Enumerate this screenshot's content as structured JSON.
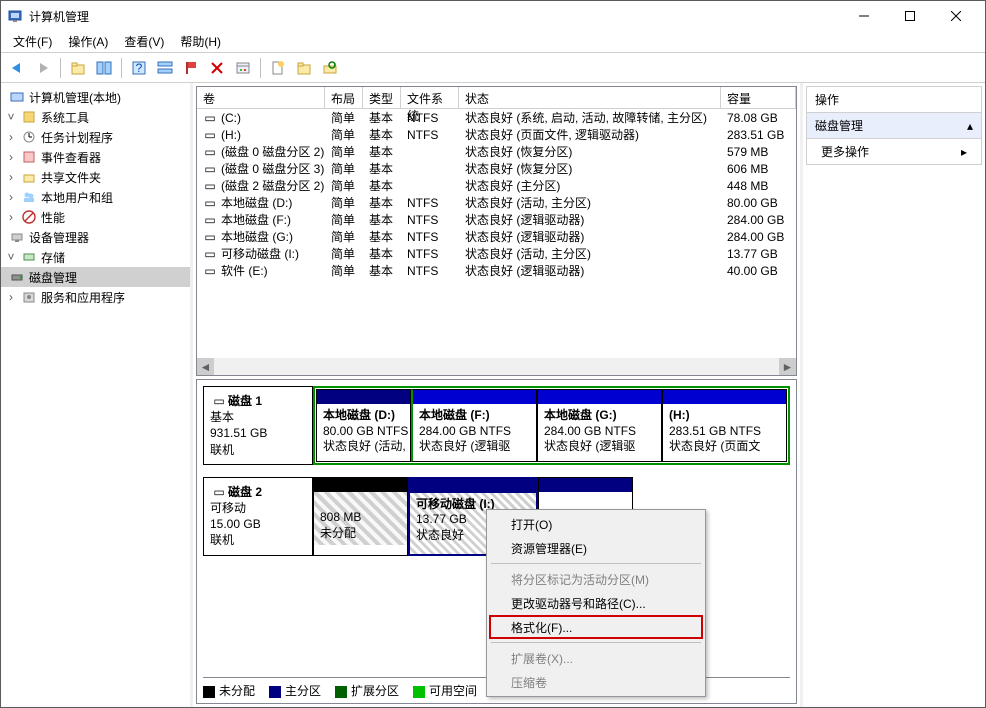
{
  "window": {
    "title": "计算机管理"
  },
  "menu": {
    "file": "文件(F)",
    "action": "操作(A)",
    "view": "查看(V)",
    "help": "帮助(H)"
  },
  "tree": {
    "root": "计算机管理(本地)",
    "sys_tools": "系统工具",
    "task_scheduler": "任务计划程序",
    "event_viewer": "事件查看器",
    "shared_folders": "共享文件夹",
    "local_users": "本地用户和组",
    "performance": "性能",
    "device_manager": "设备管理器",
    "storage": "存储",
    "disk_management": "磁盘管理",
    "services_apps": "服务和应用程序"
  },
  "vol_header": {
    "volume": "卷",
    "layout": "布局",
    "type": "类型",
    "fs": "文件系统",
    "status": "状态",
    "capacity": "容量"
  },
  "volumes": [
    {
      "name": "(C:)",
      "layout": "简单",
      "type": "基本",
      "fs": "NTFS",
      "status": "状态良好 (系统, 启动, 活动, 故障转储, 主分区)",
      "cap": "78.08 GB"
    },
    {
      "name": "(H:)",
      "layout": "简单",
      "type": "基本",
      "fs": "NTFS",
      "status": "状态良好 (页面文件, 逻辑驱动器)",
      "cap": "283.51 GB"
    },
    {
      "name": "(磁盘 0 磁盘分区 2)",
      "layout": "简单",
      "type": "基本",
      "fs": "",
      "status": "状态良好 (恢复分区)",
      "cap": "579 MB"
    },
    {
      "name": "(磁盘 0 磁盘分区 3)",
      "layout": "简单",
      "type": "基本",
      "fs": "",
      "status": "状态良好 (恢复分区)",
      "cap": "606 MB"
    },
    {
      "name": "(磁盘 2 磁盘分区 2)",
      "layout": "简单",
      "type": "基本",
      "fs": "",
      "status": "状态良好 (主分区)",
      "cap": "448 MB"
    },
    {
      "name": "本地磁盘 (D:)",
      "layout": "简单",
      "type": "基本",
      "fs": "NTFS",
      "status": "状态良好 (活动, 主分区)",
      "cap": "80.00 GB"
    },
    {
      "name": "本地磁盘 (F:)",
      "layout": "简单",
      "type": "基本",
      "fs": "NTFS",
      "status": "状态良好 (逻辑驱动器)",
      "cap": "284.00 GB"
    },
    {
      "name": "本地磁盘 (G:)",
      "layout": "简单",
      "type": "基本",
      "fs": "NTFS",
      "status": "状态良好 (逻辑驱动器)",
      "cap": "284.00 GB"
    },
    {
      "name": "可移动磁盘 (I:)",
      "layout": "简单",
      "type": "基本",
      "fs": "NTFS",
      "status": "状态良好 (活动, 主分区)",
      "cap": "13.77 GB"
    },
    {
      "name": "软件 (E:)",
      "layout": "简单",
      "type": "基本",
      "fs": "NTFS",
      "status": "状态良好 (逻辑驱动器)",
      "cap": "40.00 GB"
    }
  ],
  "disk1": {
    "title": "磁盘 1",
    "type": "基本",
    "size": "931.51 GB",
    "status": "联机",
    "parts": [
      {
        "label": "本地磁盘   (D:)",
        "size": "80.00 GB NTFS",
        "status": "状态良好 (活动, "
      },
      {
        "label": "本地磁盘   (F:)",
        "size": "284.00 GB NTFS",
        "status": "状态良好 (逻辑驱"
      },
      {
        "label": "本地磁盘   (G:)",
        "size": "284.00 GB NTFS",
        "status": "状态良好 (逻辑驱"
      },
      {
        "label": "(H:)",
        "size": "283.51 GB NTFS",
        "status": "状态良好 (页面文"
      }
    ]
  },
  "disk2": {
    "title": "磁盘 2",
    "type": "可移动",
    "size": "15.00 GB",
    "status": "联机",
    "unalloc_size": "808 MB",
    "unalloc_label": "未分配",
    "part": {
      "label": "可移动磁盘   (I:)",
      "size": "13.77 GB",
      "status": "状态良好"
    }
  },
  "legend": {
    "unalloc": "未分配",
    "primary": "主分区",
    "extended": "扩展分区",
    "free": "可用空间"
  },
  "actions": {
    "header": "操作",
    "disk_mgmt": "磁盘管理",
    "more": "更多操作"
  },
  "ctx": {
    "open": "打开(O)",
    "explorer": "资源管理器(E)",
    "mark_active": "将分区标记为活动分区(M)",
    "change_letter": "更改驱动器号和路径(C)...",
    "format": "格式化(F)...",
    "extend": "扩展卷(X)...",
    "shrink": "压缩卷"
  }
}
